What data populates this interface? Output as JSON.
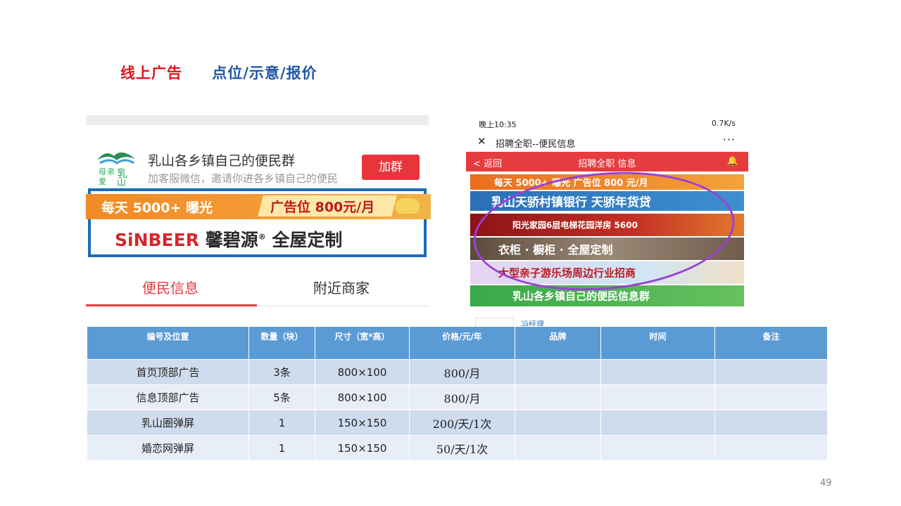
{
  "title": {
    "red": "线上广告",
    "blue": "点位/示意/报价"
  },
  "left_shot": {
    "group_name": "乳山各乡镇自己的便民群",
    "group_sub": "加客服微信，邀请你进各乡镇自己的便民",
    "join_label": "加群",
    "banner1_left": "每天 5000+ 曝光",
    "banner1_right": "广告位 800元/月",
    "brand_en": "SiNBEER",
    "brand_cn": "馨碧源",
    "brand_reg": "®",
    "brand_slogan": "全屋定制",
    "tabs": [
      "便民信息",
      "附近商家"
    ]
  },
  "right_shot": {
    "status_left": "晚上10:35",
    "status_right": "0.7K/s",
    "wx_close": "✕",
    "wx_title": "招聘全职--便民信息",
    "wx_more": "···",
    "nav_back": "< 返回",
    "nav_title": "招聘全职 信息",
    "banners": [
      "每天 5000+ 曝光    广告位 800 元/月",
      "乳山天骄村镇银行   天骄年货贷",
      "阳光家园6层电梯花园洋房   5600",
      "衣柜 · 橱柜 · 全屋定制",
      "大型亲子游乐场周边行业招商",
      "乳山各乡镇自己的便民信息群"
    ],
    "below_text": "冯经理"
  },
  "table": {
    "headers": [
      "编号及位置",
      "数量（块）",
      "尺寸（宽*高）",
      "价格/元/年",
      "品牌",
      "时间",
      "备注"
    ],
    "rows": [
      [
        "首页顶部广告",
        "3条",
        "800×100",
        "800/月",
        "",
        "",
        ""
      ],
      [
        "信息顶部广告",
        "5条",
        "800×100",
        "800/月",
        "",
        "",
        ""
      ],
      [
        "乳山圈弹屏",
        "1",
        "150×150",
        "200/天/1次",
        "",
        "",
        ""
      ],
      [
        "婚恋网弹屏",
        "1",
        "150×150",
        "50/天/1次",
        "",
        "",
        ""
      ]
    ]
  },
  "page_number": "49",
  "colors": {
    "title_red": "#e0141b",
    "title_blue": "#1f57a8",
    "table_header": "#5b9bd5",
    "ad_frame": "#1b6cb7",
    "ellipse": "#9c3fd6"
  }
}
